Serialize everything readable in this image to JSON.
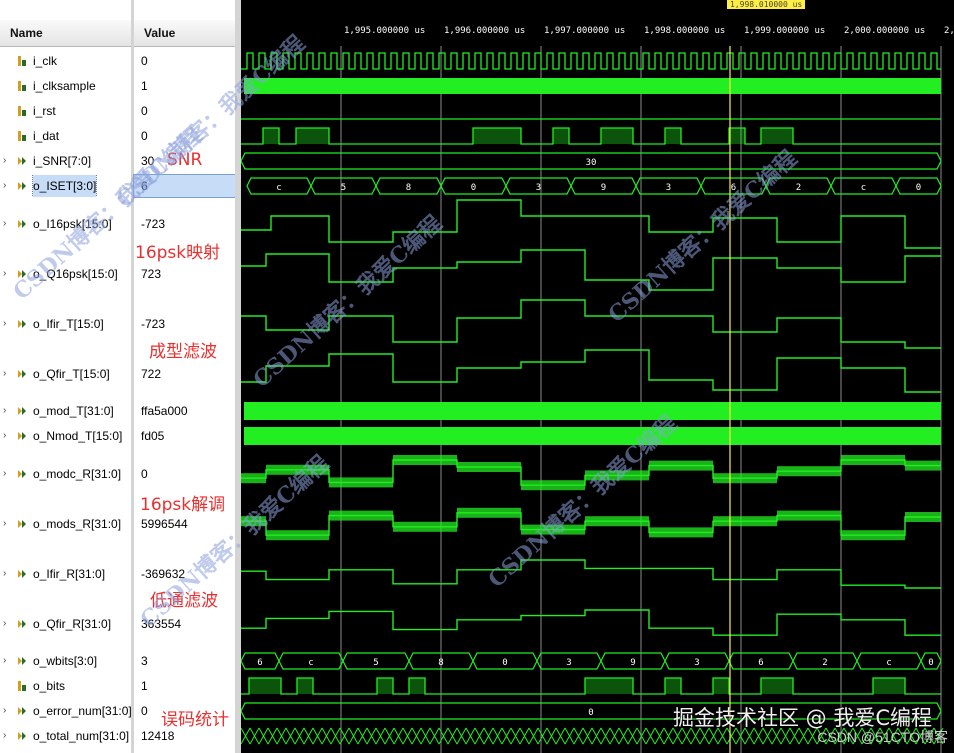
{
  "headers": {
    "name": "Name",
    "value": "Value"
  },
  "timeline": {
    "cursor_label": "1,998.010000 us",
    "ticks": [
      "1,995.000000 us",
      "1,996.000000 us",
      "1,997.000000 us",
      "1,998.000000 us",
      "1,999.000000 us",
      "2,000.000000 us",
      "2,"
    ]
  },
  "signals": [
    {
      "name": "i_clk",
      "value": "0",
      "bus": false,
      "icon": "bit-signal-icon"
    },
    {
      "name": "i_clksample",
      "value": "1",
      "bus": false,
      "icon": "bit-signal-icon"
    },
    {
      "name": "i_rst",
      "value": "0",
      "bus": false,
      "icon": "bit-signal-icon"
    },
    {
      "name": "i_dat",
      "value": "0",
      "bus": false,
      "icon": "bit-signal-icon"
    },
    {
      "name": "i_SNR[7:0]",
      "value": "30",
      "bus": true,
      "icon": "bus-signal-icon"
    },
    {
      "name": "o_ISET[3:0]",
      "value": "6",
      "bus": true,
      "icon": "bus-signal-icon",
      "selected": true
    },
    {
      "name": "o_I16psk[15:0]",
      "value": "-723",
      "bus": true,
      "icon": "bus-signal-icon"
    },
    {
      "name": "o_Q16psk[15:0]",
      "value": "723",
      "bus": true,
      "icon": "bus-signal-icon"
    },
    {
      "name": "o_Ifir_T[15:0]",
      "value": "-723",
      "bus": true,
      "icon": "bus-signal-icon"
    },
    {
      "name": "o_Qfir_T[15:0]",
      "value": "722",
      "bus": true,
      "icon": "bus-signal-icon"
    },
    {
      "name": "o_mod_T[31:0]",
      "value": "ffa5a000",
      "bus": true,
      "icon": "bus-signal-icon"
    },
    {
      "name": "o_Nmod_T[15:0]",
      "value": "fd05",
      "bus": true,
      "icon": "bus-signal-icon"
    },
    {
      "name": "o_modc_R[31:0]",
      "value": "0",
      "bus": true,
      "icon": "bus-signal-icon"
    },
    {
      "name": "o_mods_R[31:0]",
      "value": "5996544",
      "bus": true,
      "icon": "bus-signal-icon"
    },
    {
      "name": "o_Ifir_R[31:0]",
      "value": "-369632",
      "bus": true,
      "icon": "bus-signal-icon"
    },
    {
      "name": "o_Qfir_R[31:0]",
      "value": "363554",
      "bus": true,
      "icon": "bus-signal-icon"
    },
    {
      "name": "o_wbits[3:0]",
      "value": "3",
      "bus": true,
      "icon": "bus-signal-icon"
    },
    {
      "name": "o_bits",
      "value": "1",
      "bus": false,
      "icon": "bit-signal-icon"
    },
    {
      "name": "o_error_num[31:0]",
      "value": "0",
      "bus": true,
      "icon": "bus-signal-icon"
    },
    {
      "name": "o_total_num[31:0]",
      "value": "12418",
      "bus": true,
      "icon": "bus-signal-icon"
    }
  ],
  "bus_labels": {
    "snr": [
      "30"
    ],
    "iset": [
      "c",
      "5",
      "8",
      "0",
      "3",
      "9",
      "3",
      "6",
      "2",
      "c",
      "0"
    ],
    "wbits": [
      "6",
      "c",
      "5",
      "8",
      "0",
      "3",
      "9",
      "3",
      "6",
      "2",
      "c",
      "0"
    ],
    "error_num": [
      "0"
    ]
  },
  "annotations": [
    "SNR",
    "16psk映射",
    "成型滤波",
    "16psk解调",
    "低通滤波",
    "误码统计"
  ],
  "watermarks": [
    "CSDN博客：我爱C编程",
    "CSDN博客：我爱C编程",
    "CSDN博客：我爱C编程",
    "CSDN博客：我爱C编程",
    "CSDN博客：我爱C编程",
    "CSDN博客：我爱C编程"
  ],
  "footer": {
    "main": "掘金技术社区 @ 我爱C编程",
    "sub": "CSDN @51CTO博客"
  },
  "colors": {
    "wave": "#22ee22",
    "grid": "#2a4a2a",
    "cursor": "#ffee44",
    "annotation": "#e83030"
  }
}
